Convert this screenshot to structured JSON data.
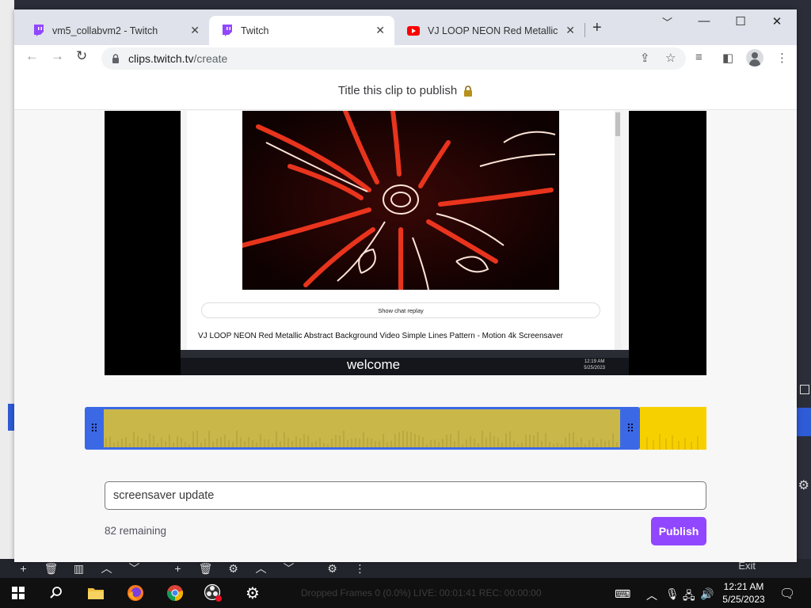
{
  "browser": {
    "tabs": [
      {
        "title": "vm5_collabvm2 - Twitch",
        "icon": "twitch-icon",
        "active": false
      },
      {
        "title": "Twitch",
        "icon": "twitch-icon",
        "active": true
      },
      {
        "title": "VJ LOOP NEON Red Metallic Abs",
        "icon": "youtube-icon",
        "active": false
      }
    ],
    "url_host": "clips.twitch.tv",
    "url_path": "/create"
  },
  "page": {
    "header_title": "Title this clip to publish",
    "clip_title_value": "screensaver update",
    "remaining_text": "82 remaining",
    "publish_label": "Publish"
  },
  "video_preview": {
    "show_chat_replay": "Show chat replay",
    "inner_video_title": "VJ LOOP NEON Red Metallic Abstract Background Video Simple Lines Pattern - Motion 4k Screensaver",
    "overlay_text": "welcome",
    "inner_time": "12:19 AM",
    "inner_date": "5/25/2023"
  },
  "background_app": {
    "exit_label": "Exit",
    "status_text": "Dropped Frames 0 (0.0%)   LIVE: 00:01:41   REC: 00:00:00"
  },
  "taskbar": {
    "time": "12:21 AM",
    "date": "5/25/2023"
  },
  "colors": {
    "twitch_purple": "#9147ff",
    "timeline_blue": "#3b69e6",
    "timeline_yellow": "#f7d000"
  }
}
